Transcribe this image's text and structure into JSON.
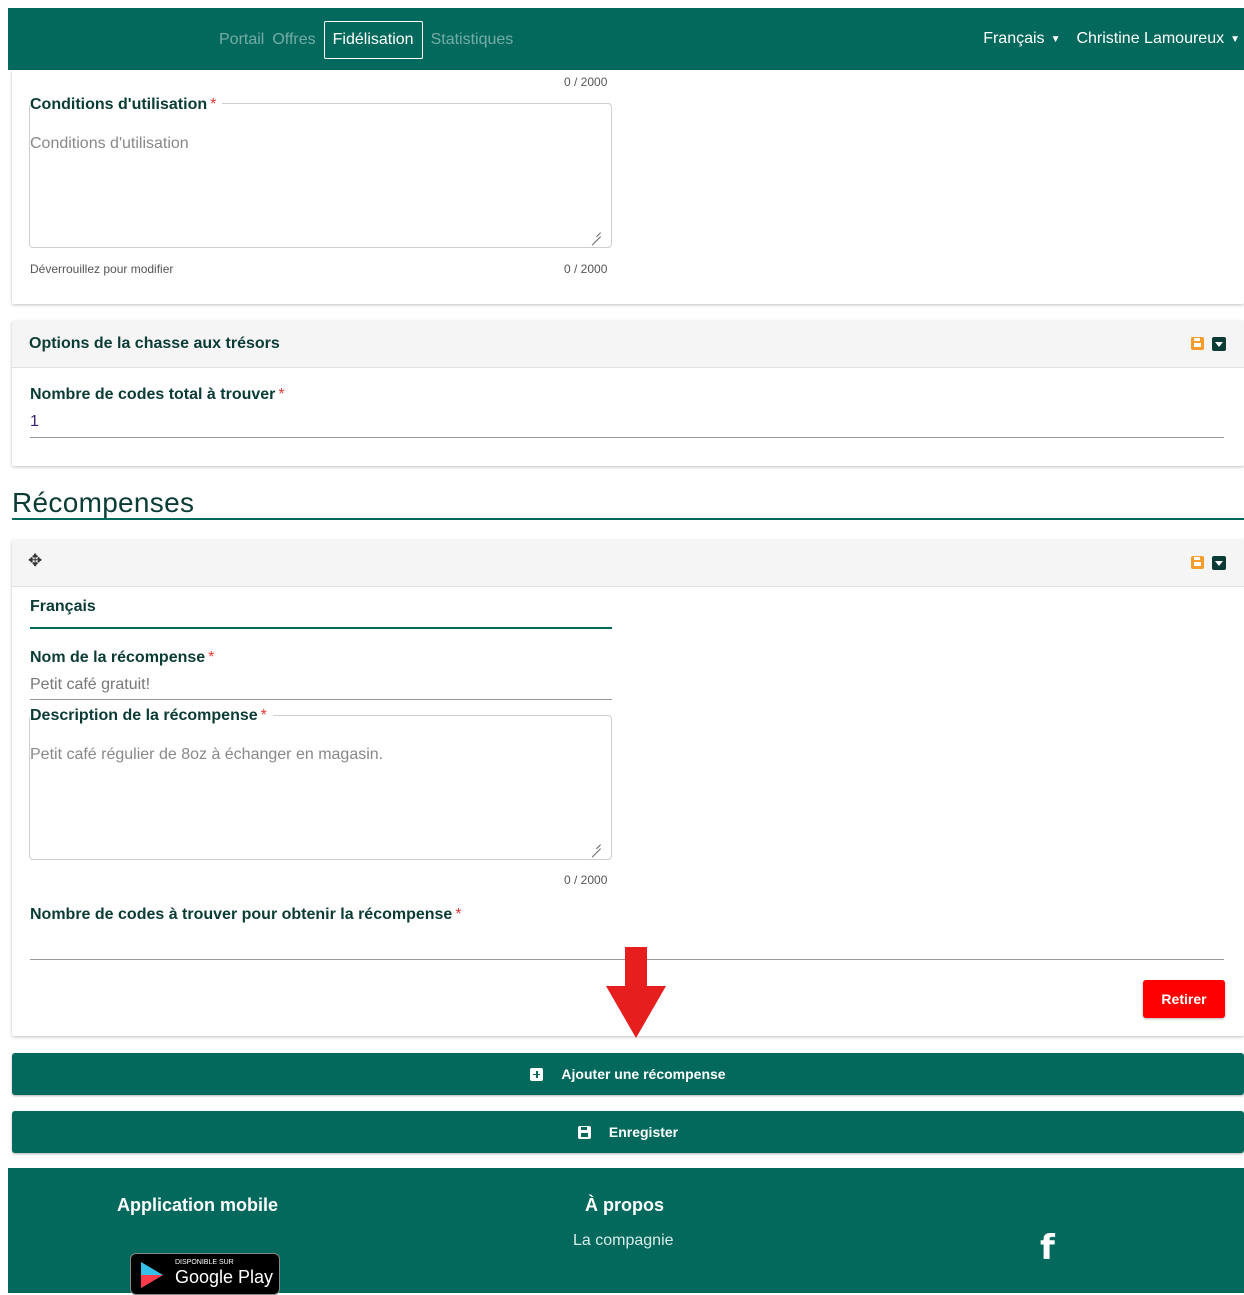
{
  "nav": {
    "tabs": [
      "Portail",
      "Offres",
      "Fidélisation",
      "Statistiques"
    ],
    "active_tab": "Fidélisation",
    "language": "Français",
    "user": "Christine Lamoureux"
  },
  "conditions": {
    "top_counter": "0 / 2000",
    "label": "Conditions d'utilisation",
    "required_mark": "*",
    "placeholder": "Conditions d'utilisation",
    "hint": "Déverrouillez pour modifier",
    "counter": "0 / 2000"
  },
  "treasure": {
    "title": "Options de la chasse aux trésors",
    "field_label": "Nombre de codes total à trouver",
    "required_mark": "*",
    "value": "1"
  },
  "rewards": {
    "section_title": "Récompenses",
    "move_icon": "move-icon",
    "lang_tab": "Français",
    "name_label": "Nom de la récompense",
    "name_value": "Petit café gratuit!",
    "desc_label": "Description de la récompense",
    "desc_value": "Petit café régulier de 8oz à échanger en magasin.",
    "desc_counter": "0 / 2000",
    "codes_label": "Nombre de codes à trouver pour obtenir la récompense",
    "required_mark": "*",
    "remove_button": "Retirer"
  },
  "actions": {
    "add_reward": "Ajouter une récompense",
    "save": "Enregister"
  },
  "footer": {
    "mobile_title": "Application mobile",
    "gplay_small": "DISPONIBLE SUR",
    "gplay_big": "Google Play",
    "about_title": "À propos",
    "about_link": "La compagnie",
    "facebook_icon": "f"
  },
  "colors": {
    "brand": "#03695c",
    "danger": "#ff0000",
    "accent": "#f59c2a",
    "annotation_arrow": "#e61e1e"
  }
}
